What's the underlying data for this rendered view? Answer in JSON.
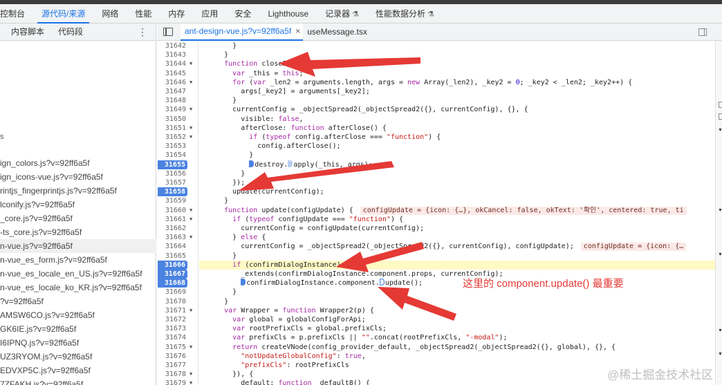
{
  "devtools": {
    "tabs": [
      {
        "label": "控制台"
      },
      {
        "label": "源代码/来源"
      },
      {
        "label": "网络"
      },
      {
        "label": "性能"
      },
      {
        "label": "内存"
      },
      {
        "label": "应用"
      },
      {
        "label": "安全"
      },
      {
        "label": "Lighthouse"
      },
      {
        "label": "记录器"
      },
      {
        "label": "性能数据分析"
      }
    ],
    "active_tab": "源代码/来源"
  },
  "sidebar": {
    "tabs": [
      "内容脚本",
      "代码段"
    ],
    "more": "⋮",
    "letter": "s",
    "files": [
      "ign_colors.js?v=92ff6a5f",
      "ign_icons-vue.js?v=92ff6a5f",
      "rintjs_fingerprintjs.js?v=92ff6a5f",
      "lconify.js?v=92ff6a5f",
      "_core.js?v=92ff6a5f",
      "-ts_core.js?v=92ff6a5f",
      "n-vue.js?v=92ff6a5f",
      "n-vue_es_form.js?v=92ff6a5f",
      "n-vue_es_locale_en_US.js?v=92ff6a5f",
      "n-vue_es_locale_ko_KR.js?v=92ff6a5f",
      "?v=92ff6a5f",
      "AMSW6CO.js?v=92ff6a5f",
      "GK6IE.js?v=92ff6a5f",
      "I6IPNQ.js?v=92ff6a5f",
      "UZ3RYOM.js?v=92ff6a5f",
      "EDVXP5C.js?v=92ff6a5f",
      "7ZFAKH.js?v=92ff6a5f"
    ],
    "selected_index": 6
  },
  "editor": {
    "tabs": [
      {
        "label": "ant-design-vue.js?v=92ff6a5f",
        "close": "×"
      },
      {
        "label": "useMessage.tsx"
      }
    ],
    "lines": [
      {
        "n": "31642",
        "code": "    }"
      },
      {
        "n": "31643",
        "code": "  }"
      },
      {
        "n": "31644",
        "code": "  function close2() {",
        "fold": true
      },
      {
        "n": "31645",
        "code": "    var _this = this;"
      },
      {
        "n": "31646",
        "code": "    for (var _len2 = arguments.length, args = new Array(_len2), _key2 = 0; _key2 < _len2; _key2++) {",
        "fold": true
      },
      {
        "n": "31647",
        "code": "      args[_key2] = arguments[_key2];"
      },
      {
        "n": "31648",
        "code": "    }"
      },
      {
        "n": "31649",
        "code": "    currentConfig = _objectSpread2(_objectSpread2({}, currentConfig), {}, {",
        "fold": true
      },
      {
        "n": "31650",
        "code": "      visible: false,"
      },
      {
        "n": "31651",
        "code": "      afterClose: function afterClose() {",
        "fold": true
      },
      {
        "n": "31652",
        "code": "        if (typeof config.afterClose === \"function\") {",
        "fold": true
      },
      {
        "n": "31653",
        "code": "          config.afterClose();"
      },
      {
        "n": "31654",
        "code": "        }"
      },
      {
        "n": "31655",
        "code": "        destroy.apply(_this, args);",
        "bp": true
      },
      {
        "n": "31656",
        "code": "      }"
      },
      {
        "n": "31657",
        "code": "    });"
      },
      {
        "n": "31658",
        "code": "    update(currentConfig);",
        "bp": true
      },
      {
        "n": "31659",
        "code": "  }"
      },
      {
        "n": "31660",
        "code": "  function update(configUpdate) {",
        "fold": true
      },
      {
        "n": "31661",
        "code": "    if (typeof configUpdate === \"function\") {",
        "fold": true
      },
      {
        "n": "31662",
        "code": "      currentConfig = configUpdate(currentConfig);"
      },
      {
        "n": "31663",
        "code": "    } else {",
        "fold": true
      },
      {
        "n": "31664",
        "code": "      currentConfig = _objectSpread2(_objectSpread2({}, currentConfig), configUpdate);"
      },
      {
        "n": "31665",
        "code": "    }"
      },
      {
        "n": "31666",
        "code": "    if (confirmDialogInstance) {",
        "bp": true,
        "highlight": true
      },
      {
        "n": "31667",
        "code": "      _extends(confirmDialogInstance.component.props, currentConfig);",
        "bp": true
      },
      {
        "n": "31668",
        "code": "      confirmDialogInstance.component.update();",
        "bp": true
      },
      {
        "n": "31669",
        "code": "    }"
      },
      {
        "n": "31670",
        "code": "  }"
      },
      {
        "n": "31671",
        "code": "  var Wrapper = function Wrapper2(p) {",
        "fold": true
      },
      {
        "n": "31672",
        "code": "    var global = globalConfigForApi;"
      },
      {
        "n": "31673",
        "code": "    var rootPrefixCls = global.prefixCls;"
      },
      {
        "n": "31674",
        "code": "    var prefixCls = p.prefixCls || \"\".concat(rootPrefixCls, \"-modal\");"
      },
      {
        "n": "31675",
        "code": "    return createVNode(config_provider_default, _objectSpread2(_objectSpread2({}, global), {}, {",
        "fold": true
      },
      {
        "n": "31676",
        "code": "      \"notUpdateGlobalConfig\": true,"
      },
      {
        "n": "31677",
        "code": "      \"prefixCls\": rootPrefixCls"
      },
      {
        "n": "31678",
        "code": "    }), {",
        "fold": true
      },
      {
        "n": "31679",
        "code": "      default: function _default8() {",
        "fold": true
      }
    ],
    "inline_values": [
      {
        "line": "31660",
        "text": "configUpdate = {icon: {…}, okCancel: false, okText: '확인', centered: true, ti"
      },
      {
        "line": "31664",
        "text": "configUpdate = {icon: {…"
      }
    ]
  },
  "annotation": "这里的 component.update() 最重要",
  "watermark": "@稀土掘金技术社区",
  "colors": {
    "accent": "#1a73e8",
    "breakpoint": "#4a82e0",
    "arrow": "#e53935",
    "highlight": "#fff9c4"
  }
}
